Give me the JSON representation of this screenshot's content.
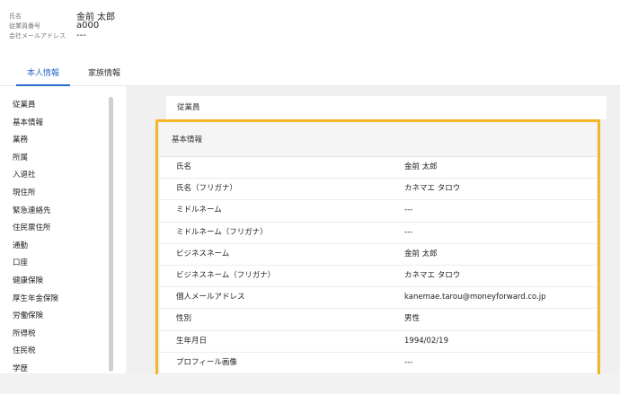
{
  "employee": {
    "name_label": "氏名",
    "name_value": "金前 太郎",
    "number_label": "従業員番号",
    "number_value": "a000",
    "email_label": "会社メールアドレス",
    "email_value": "---"
  },
  "tabs": [
    {
      "label": "本人情報",
      "active": true
    },
    {
      "label": "家族情報",
      "active": false
    }
  ],
  "sidebar": {
    "items": [
      "従業員",
      "基本情報",
      "業務",
      "所属",
      "入退社",
      "現住所",
      "緊急連絡先",
      "住民票住所",
      "通勤",
      "口座",
      "健康保険",
      "厚生年金保険",
      "労働保険",
      "所得税",
      "住民税",
      "学歴"
    ]
  },
  "section": {
    "title": "従業員"
  },
  "basic_info": {
    "title": "基本情報",
    "rows": [
      {
        "label": "氏名",
        "value": "金前 太郎"
      },
      {
        "label": "氏名（フリガナ）",
        "value": "カネマエ タロウ"
      },
      {
        "label": "ミドルネーム",
        "value": "---"
      },
      {
        "label": "ミドルネーム（フリガナ）",
        "value": "---"
      },
      {
        "label": "ビジネスネーム",
        "value": "金前 太郎"
      },
      {
        "label": "ビジネスネーム（フリガナ）",
        "value": "カネマエ タロウ"
      },
      {
        "label": "個人メールアドレス",
        "value": "kanemae.tarou@moneyforward.co.jp"
      },
      {
        "label": "性別",
        "value": "男性"
      },
      {
        "label": "生年月日",
        "value": "1994/02/19"
      },
      {
        "label": "プロフィール画像",
        "value": "---"
      }
    ]
  },
  "colors": {
    "accent": "#2a6ac7",
    "highlight": "#f4b528"
  }
}
